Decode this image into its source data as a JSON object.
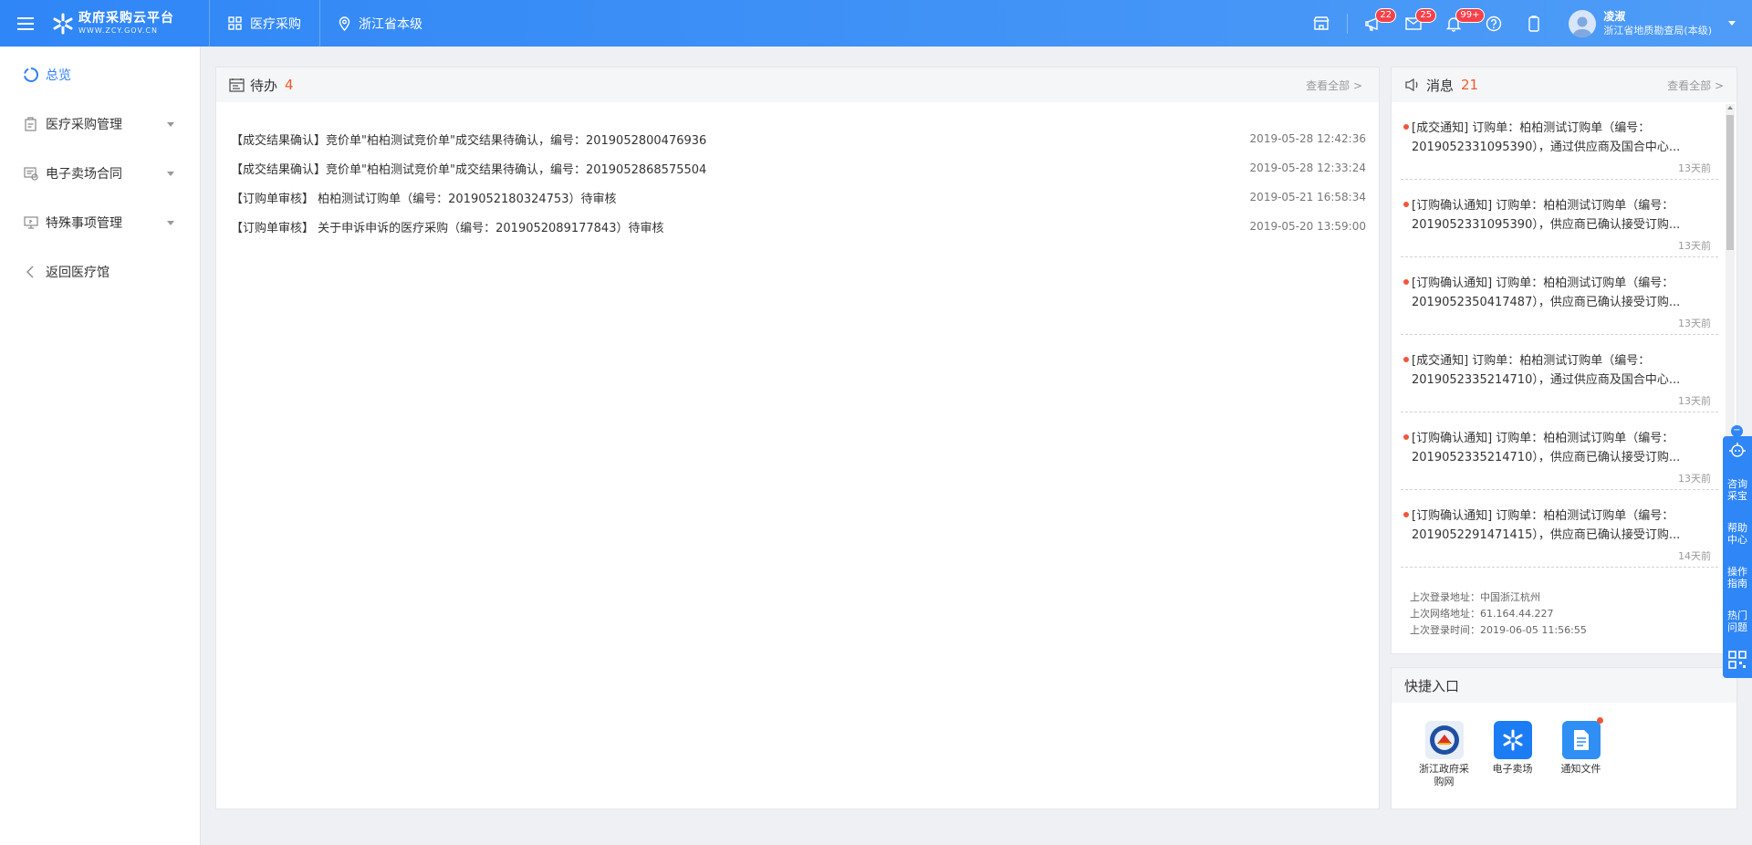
{
  "header": {
    "logo_title": "政府采购云平台",
    "logo_sub": "WWW.ZCY.GOV.CN",
    "nav_procurement": "医疗采购",
    "nav_region": "浙江省本级",
    "badge_announce": "22",
    "badge_mail": "25",
    "badge_notify": "99+",
    "user_name": "凌淑",
    "user_org": "浙江省地质勘查局(本级)"
  },
  "sidebar": {
    "items": [
      {
        "label": "总览"
      },
      {
        "label": "医疗采购管理"
      },
      {
        "label": "电子卖场合同"
      },
      {
        "label": "特殊事项管理"
      },
      {
        "label": "返回医疗馆"
      }
    ]
  },
  "todo": {
    "title": "待办",
    "count": "4",
    "view_all": "查看全部 >",
    "rows": [
      {
        "text": "【成交结果确认】竞价单\"柏柏测试竞价单\"成交结果待确认，编号：2019052800476936",
        "time": "2019-05-28 12:42:36"
      },
      {
        "text": "【成交结果确认】竞价单\"柏柏测试竞价单\"成交结果待确认，编号：2019052868575504",
        "time": "2019-05-28 12:33:24"
      },
      {
        "text": "【订购单审核】 柏柏测试订购单（编号：2019052180324753）待审核",
        "time": "2019-05-21 16:58:34"
      },
      {
        "text": "【订购单审核】 关于申诉申诉的医疗采购（编号：2019052089177843）待审核",
        "time": "2019-05-20 13:59:00"
      }
    ]
  },
  "messages": {
    "title": "消息",
    "count": "21",
    "view_all": "查看全部 >",
    "items": [
      {
        "text": "[成交通知] 订购单：柏柏测试订购单（编号：2019052331095390），通过供应商及国合中心...",
        "time": "13天前"
      },
      {
        "text": "[订购确认通知] 订购单：柏柏测试订购单（编号：2019052331095390），供应商已确认接受订购...",
        "time": "13天前"
      },
      {
        "text": "[订购确认通知] 订购单：柏柏测试订购单（编号：2019052350417487），供应商已确认接受订购...",
        "time": "13天前"
      },
      {
        "text": "[成交通知] 订购单：柏柏测试订购单（编号：2019052335214710），通过供应商及国合中心...",
        "time": "13天前"
      },
      {
        "text": "[订购确认通知] 订购单：柏柏测试订购单（编号：2019052335214710），供应商已确认接受订购...",
        "time": "13天前"
      },
      {
        "text": "[订购确认通知] 订购单：柏柏测试订购单（编号：2019052291471415），供应商已确认接受订购...",
        "time": "14天前"
      }
    ],
    "login_addr": "上次登录地址：中国浙江杭州",
    "login_ip": "上次网络地址：61.164.44.227",
    "login_time": "上次登录时间：2019-06-05 11:56:55"
  },
  "quick": {
    "title": "快捷入口",
    "items": [
      {
        "label": "浙江政府采购网",
        "color": "#e8eef8"
      },
      {
        "label": "电子卖场",
        "color": "#1b7cf3"
      },
      {
        "label": "通知文件",
        "color": "#2f8ff4"
      }
    ]
  },
  "rail": {
    "items": [
      {
        "label": "咨询采宝"
      },
      {
        "label": "帮助中心"
      },
      {
        "label": "操作指南"
      },
      {
        "label": "热门问题"
      }
    ]
  },
  "colors": {
    "accent": "#2d7ff9",
    "count_red": "#f25a2c",
    "badge_red": "#f5414a"
  }
}
